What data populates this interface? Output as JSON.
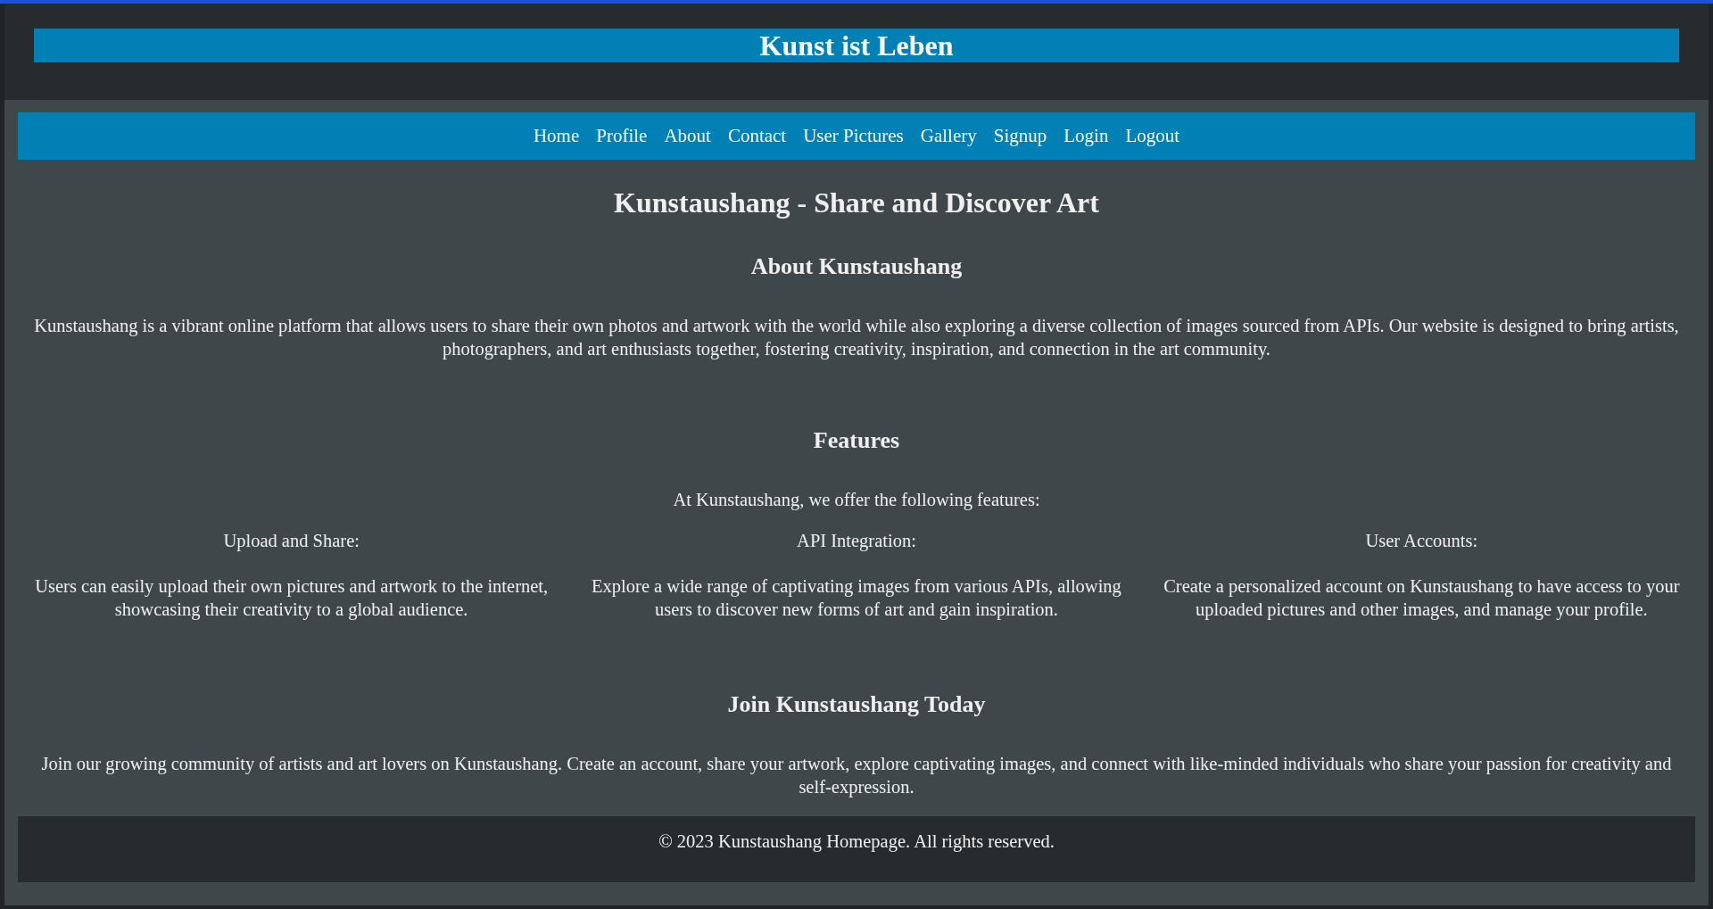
{
  "header": {
    "title": "Kunst ist Leben"
  },
  "nav": {
    "links": [
      "Home",
      "Profile",
      "About",
      "Contact",
      "User Pictures",
      "Gallery",
      "Signup",
      "Login",
      "Logout"
    ]
  },
  "main": {
    "title": "Kunstaushang - Share and Discover Art",
    "about": {
      "heading": "About Kunstaushang",
      "text": "Kunstaushang is a vibrant online platform that allows users to share their own photos and artwork with the world while also exploring a diverse collection of images sourced from APIs. Our website is designed to bring artists, photographers, and art enthusiasts together, fostering creativity, inspiration, and connection in the art community."
    },
    "features": {
      "heading": "Features",
      "intro": "At Kunstaushang, we offer the following features:",
      "items": [
        {
          "title": "Upload and Share:",
          "text": "Users can easily upload their own pictures and artwork to the internet, showcasing their creativity to a global audience."
        },
        {
          "title": "API Integration:",
          "text": "Explore a wide range of captivating images from various APIs, allowing users to discover new forms of art and gain inspiration."
        },
        {
          "title": "User Accounts:",
          "text": "Create a personalized account on Kunstaushang to have access to your uploaded pictures and other images, and manage your profile."
        }
      ]
    },
    "join": {
      "heading": "Join Kunstaushang Today",
      "text": "Join our growing community of artists and art lovers on Kunstaushang. Create an account, share your artwork, explore captivating images, and connect with like-minded individuals who share your passion for creativity and self-expression."
    }
  },
  "footer": {
    "text": "© 2023 Kunstaushang Homepage. All rights reserved."
  }
}
